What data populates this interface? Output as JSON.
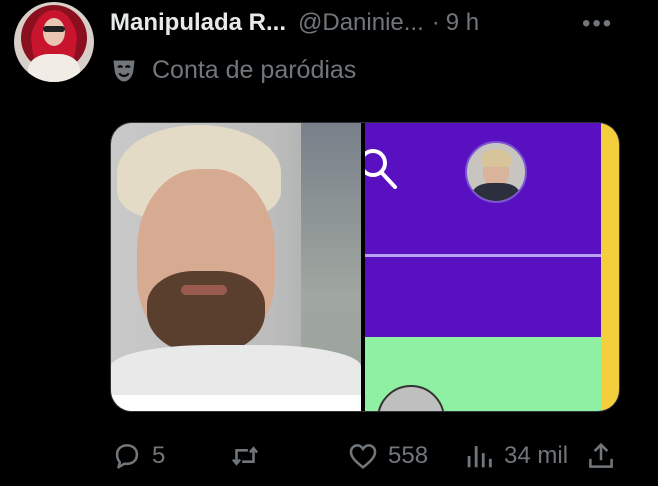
{
  "tweet": {
    "author": {
      "display_name": "Manipulada R...",
      "handle": "@Daninie...",
      "separator": "·",
      "time": "9 h",
      "parody_label": "Conta de paródias"
    },
    "more_label": "•••",
    "actions": {
      "replies": "5",
      "likes": "558",
      "views": "34 mil"
    }
  },
  "icons": {
    "parody": "theater-mask-icon",
    "reply": "reply-bubble-icon",
    "retweet": "retweet-icon",
    "like": "heart-icon",
    "views": "views-bar-icon",
    "share": "share-upload-icon",
    "search": "search-icon"
  },
  "colors": {
    "background": "#000000",
    "text_primary": "#e7e9ea",
    "text_secondary": "#71767b",
    "purple_ui": "#5810c0",
    "green_ui": "#8ff0a4",
    "yellow_ui": "#f4cf3d"
  }
}
